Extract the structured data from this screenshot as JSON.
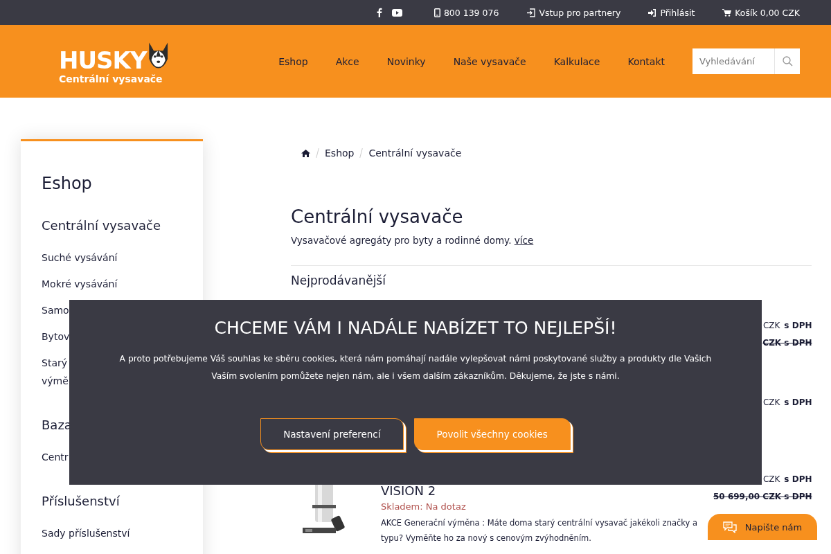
{
  "topbar": {
    "phone": "800 139 076",
    "partners": "Vstup pro partnery",
    "login": "Přihlásit",
    "cart": "Košík 0,00 CZK"
  },
  "logo": {
    "brand": "HUSKY",
    "tagline": "Centrální vysavače"
  },
  "nav": [
    "Eshop",
    "Akce",
    "Novinky",
    "Naše vysavače",
    "Kalkulace",
    "Kontakt"
  ],
  "search": {
    "placeholder": "Vyhledávání"
  },
  "sidebar": {
    "title": "Eshop",
    "sections": [
      {
        "heading": "Centrální vysavače",
        "items": [
          {
            "lines": [
              "Suché vysávání"
            ]
          },
          {
            "lines": [
              "Mokré vysávání"
            ]
          },
          {
            "lines": [
              "Samo"
            ]
          },
          {
            "lines": [
              "Bytov"
            ]
          },
          {
            "lines": [
              "Starý",
              "výmě"
            ]
          }
        ]
      },
      {
        "heading": "Baza",
        "items": [
          {
            "lines": [
              "Centr"
            ]
          }
        ]
      },
      {
        "heading": "Příslušenství",
        "items": [
          {
            "lines": [
              "Sady příslušenství"
            ]
          }
        ]
      }
    ]
  },
  "breadcrumb": [
    "Eshop",
    "Centrální vysavače"
  ],
  "category": {
    "title": "Centrální vysavače",
    "description": "Vysavačové agregáty pro byty a rodinné domy.",
    "more": "více"
  },
  "section_title": "Nejprodávanější",
  "products": [
    {
      "price": "CZK",
      "tax": "s DPH",
      "old_price": "CZK s DPH"
    },
    {
      "price": "CZK",
      "tax": "s DPH"
    },
    {
      "kind": "picture",
      "name": "VISION 2",
      "stock": "Skladem: Na dotaz",
      "description": "AKCE Generační výměna : Máte doma starý centrální vysavač jakékoli značky a typu? Vyměňte ho za nový s cenovým zvýhodněním.",
      "price": "CZK",
      "tax": "s DPH",
      "old_price": "50 699,00 CZK s DPH"
    }
  ],
  "cookie": {
    "title": "CHCEME VÁM I NADÁLE NABÍZET TO NEJLEPŠÍ!",
    "lines": [
      "A proto potřebujeme Váš souhlas ke sběru cookies, která nám pomáhají nadále vylepšovat námi poskytované služby a produkty dle Vašich",
      "Vaším svolením pomůžete nejen nám, ale i všem dalším zákazníkům. Děkujeme, že jste s námi."
    ],
    "buttons": [
      "Nastavení preferencí",
      "Povolit všechny cookies"
    ]
  },
  "chat": {
    "label": "Napište nám"
  }
}
